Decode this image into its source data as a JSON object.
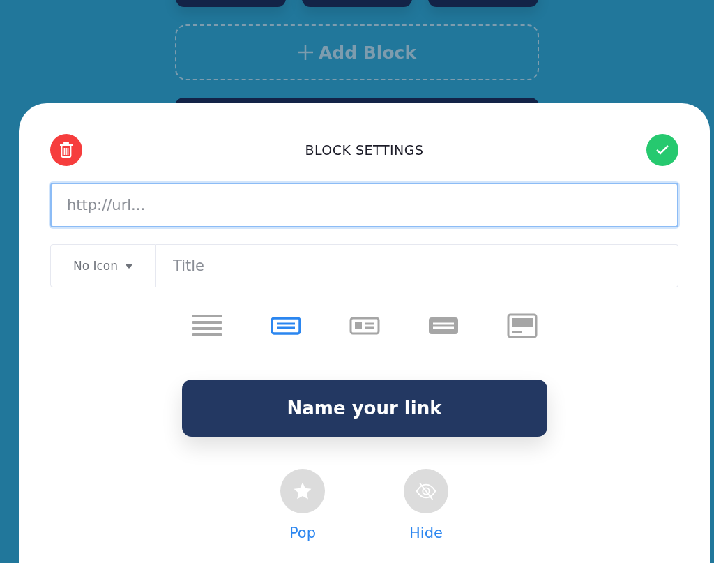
{
  "background": {
    "add_block": {
      "label": "Add Block"
    }
  },
  "sheet": {
    "title": "BLOCK SETTINGS",
    "url_field": {
      "placeholder": "http://url..."
    },
    "icon_select": {
      "value": "No Icon"
    },
    "title_field": {
      "placeholder": "Title"
    },
    "layouts": [
      {
        "kind": "list",
        "selected": false
      },
      {
        "kind": "button",
        "selected": true
      },
      {
        "kind": "thumbnail",
        "selected": false
      },
      {
        "kind": "filled",
        "selected": false
      },
      {
        "kind": "card",
        "selected": false
      }
    ],
    "preview_button": {
      "label": "Name your link"
    },
    "actions": [
      {
        "kind": "pop",
        "label": "Pop"
      },
      {
        "kind": "hide",
        "label": "Hide"
      }
    ]
  }
}
